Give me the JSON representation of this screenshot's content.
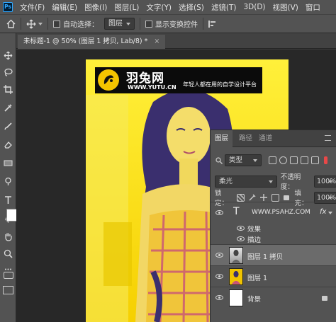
{
  "app": {
    "logo": "Ps"
  },
  "menu": [
    "文件(F)",
    "编辑(E)",
    "图像(I)",
    "图层(L)",
    "文字(Y)",
    "选择(S)",
    "滤镜(T)",
    "3D(D)",
    "视图(V)",
    "窗口"
  ],
  "options": {
    "auto_select_label": "自动选择：",
    "auto_select_value": "图层",
    "show_transform_label": "显示变换控件"
  },
  "document": {
    "tab_title": "未标题-1 @ 50% (图层 1 拷贝, Lab/8) *",
    "close_glyph": "×"
  },
  "watermark": {
    "brand": "羽兔网",
    "url": "WWW.YUTU.CN",
    "slogan": "年轻人都在用的自学设计平台"
  },
  "layers_panel": {
    "tabs": [
      "图层",
      "路径",
      "通道"
    ],
    "filter_kind": "类型",
    "blend_mode": "柔光",
    "opacity_label": "不透明度：",
    "opacity_value": "100%",
    "lock_label": "锁定：",
    "fill_label": "填充：",
    "fill_value": "100%",
    "layers": [
      {
        "name": "WWW.PSAHZ.COM",
        "fx": "fx",
        "effects_label": "效果",
        "stroke_label": "描边"
      },
      {
        "name": "图层 1 拷贝"
      },
      {
        "name": "图层 1"
      },
      {
        "name": "背景"
      }
    ]
  },
  "colors": {
    "accent": "#31a8ff",
    "doc_bg": "#ffe400",
    "panel": "#535353"
  }
}
